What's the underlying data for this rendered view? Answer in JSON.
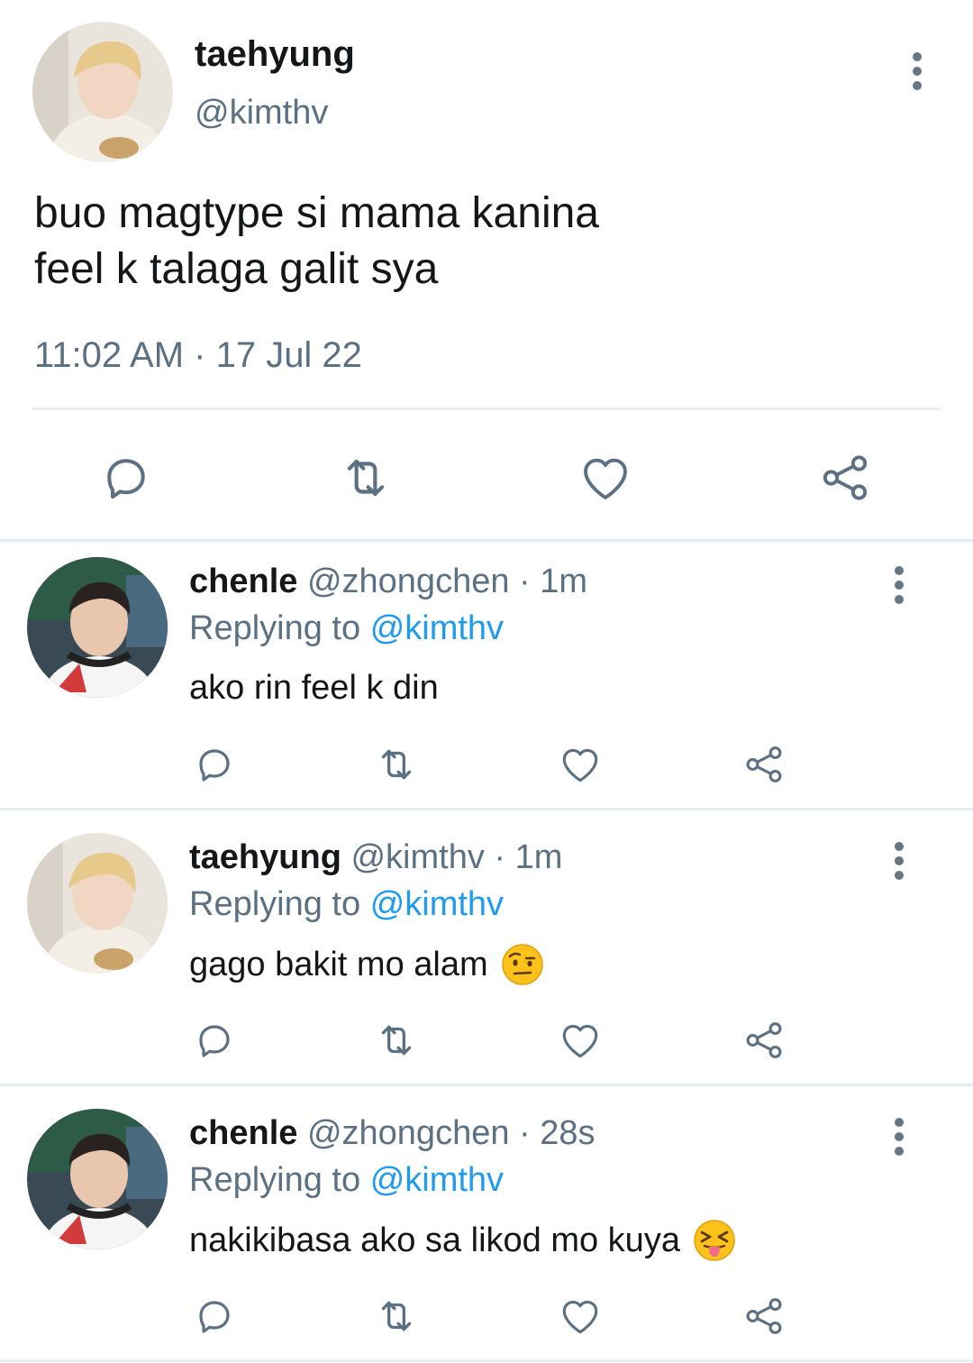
{
  "main_tweet": {
    "name": "taehyung",
    "handle": "@kimthv",
    "text": "buo magtype si mama kanina\nfeel k talaga galit sya",
    "timestamp": "11:02 AM · 17 Jul 22"
  },
  "replies": [
    {
      "name": "chenle",
      "handle": "@zhongchen",
      "time": "· 1m",
      "replying_prefix": "Replying to",
      "mention": "@kimthv",
      "text": "ako rin feel k din",
      "emoji": ""
    },
    {
      "name": "taehyung",
      "handle": "@kimthv",
      "time": "· 1m",
      "replying_prefix": "Replying to",
      "mention": "@kimthv",
      "text": "gago bakit mo alam",
      "emoji": "face-with-raised-eyebrow"
    },
    {
      "name": "chenle",
      "handle": "@zhongchen",
      "time": "· 28s",
      "replying_prefix": "Replying to",
      "mention": "@kimthv",
      "text": "nakikibasa ako sa likod mo kuya",
      "emoji": "squinting-face-with-tongue"
    }
  ],
  "icons": {
    "actions": [
      "reply-icon",
      "retweet-icon",
      "like-icon",
      "share-icon"
    ],
    "menu": "more-options-icon"
  },
  "colors": {
    "text_primary": "#14171a",
    "text_secondary": "#5b7083",
    "mention": "#1d9bf0",
    "icon": "#5b7083",
    "divider": "#e6ecf0"
  }
}
